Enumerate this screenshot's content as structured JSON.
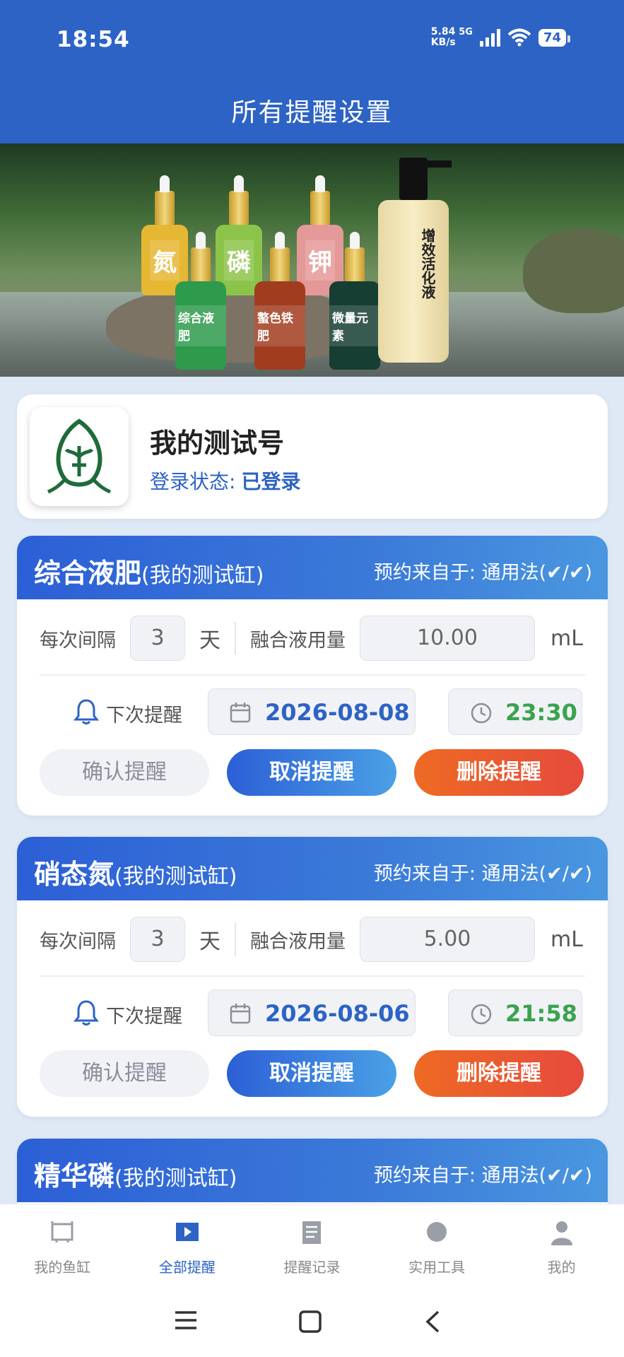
{
  "status_bar": {
    "time": "18:54",
    "net_speed_value": "5.84",
    "net_speed_unit": "KB/s",
    "network": "5G",
    "battery": "74"
  },
  "header": {
    "title": "所有提醒设置"
  },
  "banner": {
    "bottles": [
      "氮",
      "磷",
      "钾",
      "综合液肥",
      "螯色铁肥",
      "微量元素"
    ],
    "big_bottle": "增效活化液"
  },
  "account": {
    "name": "我的测试号",
    "status_label": "登录状态:",
    "status_value": "已登录"
  },
  "reminders": [
    {
      "name": "综合液肥",
      "tank": "(我的测试缸)",
      "source": "预约来自于: 通用法(✔/✔)",
      "interval_label": "每次间隔",
      "interval_value": "3",
      "interval_unit": "天",
      "dose_label": "融合液用量",
      "dose_value": "10.00",
      "dose_unit": "mL",
      "next_label": "下次提醒",
      "next_date": "2026-08-08",
      "next_time": "23:30",
      "confirm_label": "确认提醒",
      "cancel_label": "取消提醒",
      "delete_label": "删除提醒"
    },
    {
      "name": "硝态氮",
      "tank": "(我的测试缸)",
      "source": "预约来自于: 通用法(✔/✔)",
      "interval_label": "每次间隔",
      "interval_value": "3",
      "interval_unit": "天",
      "dose_label": "融合液用量",
      "dose_value": "5.00",
      "dose_unit": "mL",
      "next_label": "下次提醒",
      "next_date": "2026-08-06",
      "next_time": "21:58",
      "confirm_label": "确认提醒",
      "cancel_label": "取消提醒",
      "delete_label": "删除提醒"
    },
    {
      "name": "精华磷",
      "tank": "(我的测试缸)",
      "source": "预约来自于: 通用法(✔/✔)"
    }
  ],
  "bottom_nav": {
    "items": [
      {
        "label": "我的鱼缸",
        "icon": "fish-tank-icon"
      },
      {
        "label": "全部提醒",
        "icon": "play-icon"
      },
      {
        "label": "提醒记录",
        "icon": "document-icon"
      },
      {
        "label": "实用工具",
        "icon": "circle-icon"
      },
      {
        "label": "我的",
        "icon": "person-icon"
      }
    ],
    "active_index": 1
  },
  "colors": {
    "primary": "#2d63c4",
    "time_green": "#3aa34e",
    "delete_orange": "#ec5a2e"
  }
}
